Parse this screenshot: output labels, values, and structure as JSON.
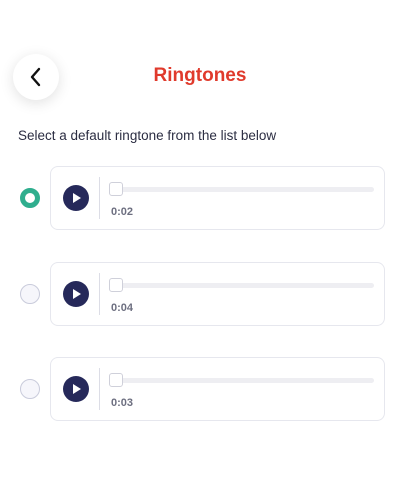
{
  "header": {
    "title": "Ringtones",
    "back_icon": "chevron-left-icon"
  },
  "subtitle": "Select a default ringtone from the list below",
  "colors": {
    "title": "#e03a2c",
    "accent": "#2fae8e",
    "play_button": "#26295a"
  },
  "ringtones": [
    {
      "duration": "0:02",
      "selected": true,
      "progress": 0
    },
    {
      "duration": "0:04",
      "selected": false,
      "progress": 0
    },
    {
      "duration": "0:03",
      "selected": false,
      "progress": 0
    }
  ]
}
